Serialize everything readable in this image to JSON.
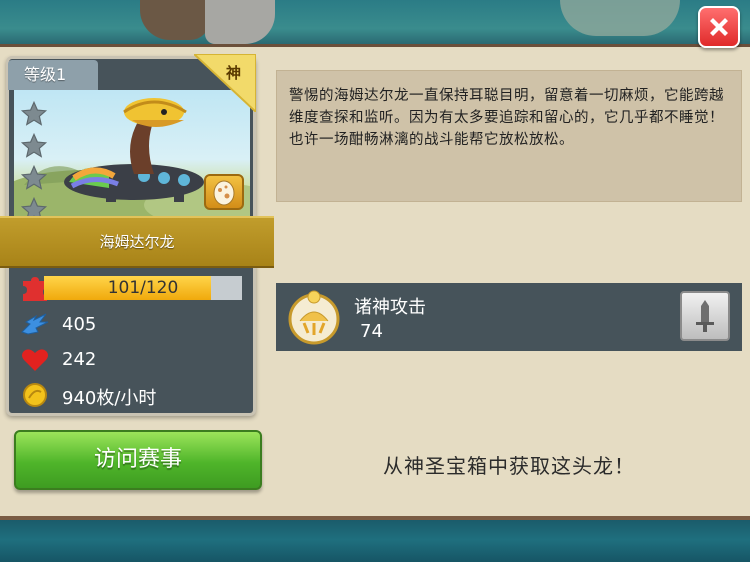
{
  "card": {
    "level": "等级1",
    "rarity": "神",
    "dragon_name": "海姆达尔龙",
    "stars": 4,
    "progress_text": "101/120",
    "progress_fraction": 0.8417,
    "attack": "405",
    "health": "242",
    "gold_rate": "940枚/小时"
  },
  "buttons": {
    "visit": "访问赛事"
  },
  "description": "警惕的海姆达尔龙一直保持耳聪目明，留意着一切麻烦，它能跨越维度查探和监听。因为有太多要追踪和留心的，它几乎都不睡觉！也许一场酣畅淋漓的战斗能帮它放松放松。",
  "ability": {
    "name": "诸神攻击",
    "value": "74"
  },
  "obtain": "从神圣宝箱中获取这头龙！",
  "colors": {
    "close": "#e02a2a",
    "visit": "#4fb52a",
    "progress": "#f0a90c",
    "panel": "#e5dcc3",
    "card": "#47535a"
  }
}
